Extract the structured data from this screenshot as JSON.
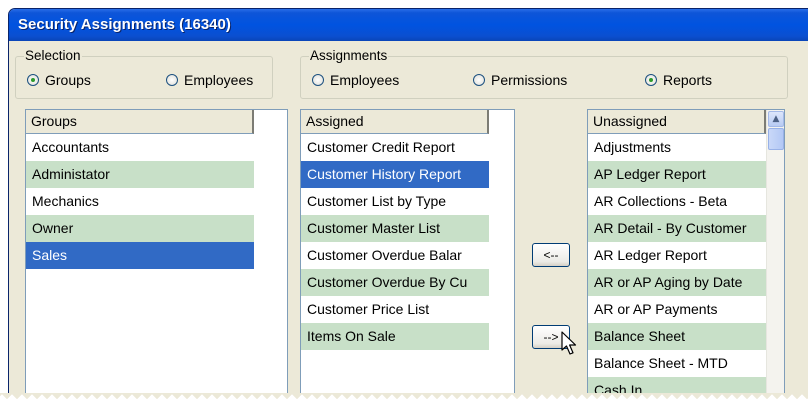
{
  "window": {
    "title": "Security Assignments (16340)"
  },
  "selection": {
    "legend": "Selection",
    "options": [
      {
        "label": "Groups",
        "checked": true
      },
      {
        "label": "Employees",
        "checked": false
      }
    ]
  },
  "assignments": {
    "legend": "Assignments",
    "options": [
      {
        "label": "Employees",
        "checked": false
      },
      {
        "label": "Permissions",
        "checked": false
      },
      {
        "label": "Reports",
        "checked": true
      }
    ]
  },
  "groups_list": {
    "header": "Groups",
    "rows": [
      "Accountants",
      "Administator",
      "Mechanics",
      "Owner",
      "Sales"
    ],
    "selected_index": 4
  },
  "assigned_list": {
    "header": "Assigned",
    "rows": [
      "Customer Credit Report",
      "Customer History Report",
      "Customer List by Type",
      "Customer Master List",
      "Customer Overdue Balar",
      "Customer Overdue By Cu",
      "Customer Price List",
      "Items On Sale"
    ],
    "selected_index": 1
  },
  "unassigned_list": {
    "header": "Unassigned",
    "rows": [
      "Adjustments",
      "AP Ledger Report",
      "AR Collections - Beta",
      "AR Detail - By Customer",
      "AR Ledger Report",
      "AR or AP Aging by Date",
      "AR or AP Payments",
      "Balance Sheet",
      "Balance Sheet - MTD",
      "Cash In"
    ]
  },
  "buttons": {
    "remove": "<--",
    "add": "-->"
  },
  "icons": {
    "scroll_up": "chevron-up-icon",
    "cursor": "mouse-pointer-icon"
  },
  "colors": {
    "title_bar": "#0053e0",
    "row_alt": "#c8e0c8",
    "row_selected": "#316ac5",
    "face": "#ece9d8"
  }
}
